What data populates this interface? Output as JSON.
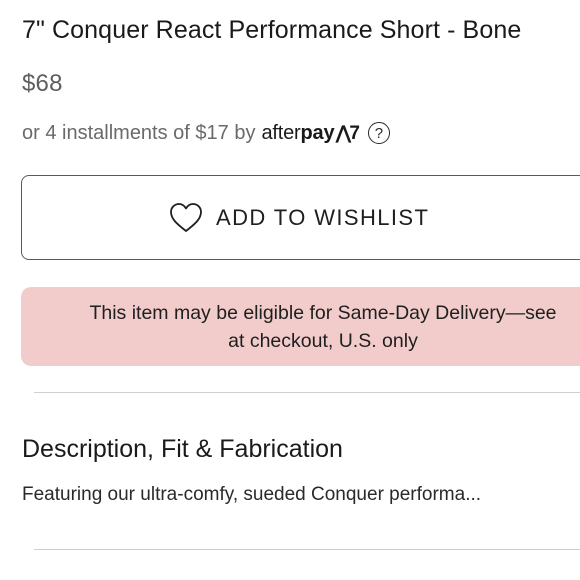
{
  "product": {
    "title": "7\" Conquer React Performance Short - Bone",
    "price": "$68"
  },
  "installments": {
    "text": "or 4 installments of $17 by",
    "provider_prefix": "after",
    "provider_bold": "pay",
    "provider_mark": "⋀7",
    "help_glyph": "?",
    "help_icon": "question-circle-icon"
  },
  "wishlist": {
    "label": "ADD TO WISHLIST",
    "icon": "heart-outline-icon"
  },
  "delivery_banner": {
    "line1": "This item may be eligible for Same-Day Delivery—see",
    "line2": "at checkout, U.S. only",
    "background": "#f2cbcb"
  },
  "description": {
    "heading": "Description, Fit & Fabrication",
    "text": "Featuring our ultra-comfy, sueded Conquer performa..."
  }
}
